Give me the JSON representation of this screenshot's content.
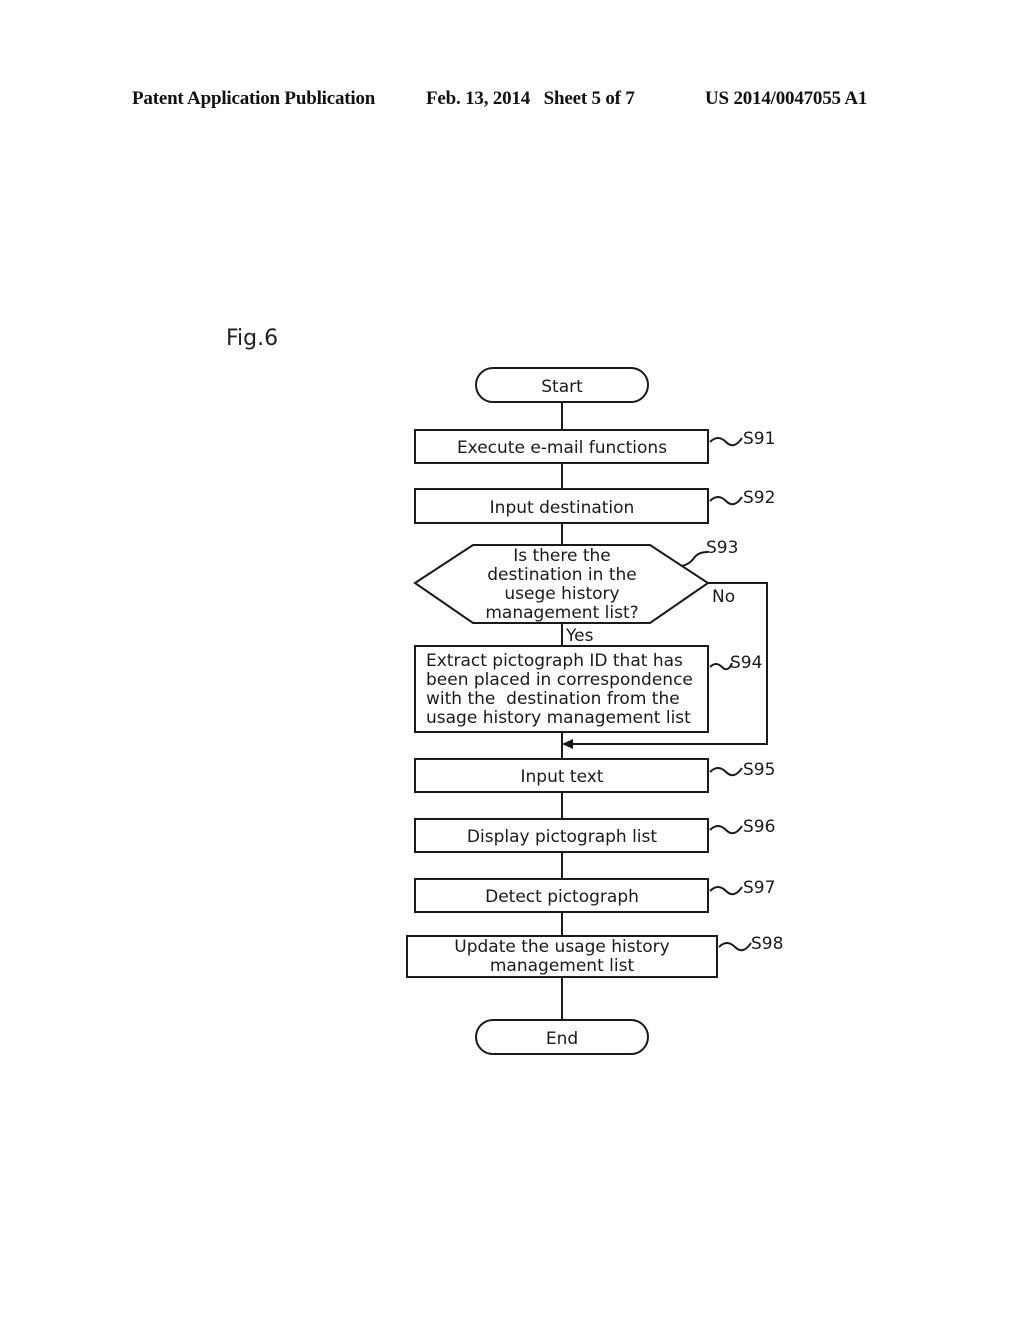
{
  "header": {
    "publication": "Patent Application Publication",
    "date_sheet": "Feb. 13, 2014   Sheet 5 of 7",
    "number": "US 2014/0047055 A1"
  },
  "figure": {
    "label": "Fig.6",
    "start": "Start",
    "end": "End",
    "steps": [
      {
        "id": "S91",
        "type": "process",
        "lines": [
          "Execute e-mail functions"
        ]
      },
      {
        "id": "S92",
        "type": "process",
        "lines": [
          "Input destination"
        ]
      },
      {
        "id": "S93",
        "type": "decision",
        "lines": [
          "Is there the",
          "destination in the",
          "usege history",
          "management list?"
        ],
        "yes_label": "Yes",
        "no_label": "No"
      },
      {
        "id": "S94",
        "type": "process",
        "lines": [
          "Extract pictograph ID that has",
          "been placed in correspondence",
          "with the  destination from the",
          "usage history management list"
        ]
      },
      {
        "id": "S95",
        "type": "process",
        "lines": [
          "Input text"
        ]
      },
      {
        "id": "S96",
        "type": "process",
        "lines": [
          "Display pictograph list"
        ]
      },
      {
        "id": "S97",
        "type": "process",
        "lines": [
          "Detect pictograph"
        ]
      },
      {
        "id": "S98",
        "type": "process",
        "lines": [
          "Update the usage history",
          "management list"
        ]
      }
    ]
  }
}
